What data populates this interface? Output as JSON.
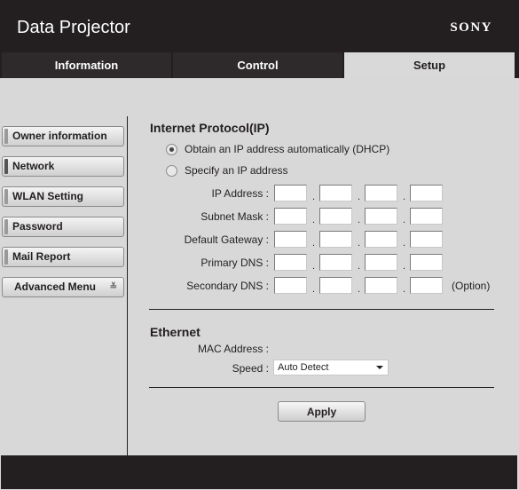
{
  "header": {
    "title": "Data Projector",
    "brand": "SONY"
  },
  "tabs": [
    {
      "label": "Information",
      "active": false
    },
    {
      "label": "Control",
      "active": false
    },
    {
      "label": "Setup",
      "active": true
    }
  ],
  "sidebar": {
    "items": [
      {
        "label": "Owner information"
      },
      {
        "label": "Network",
        "active": true
      },
      {
        "label": "WLAN Setting"
      },
      {
        "label": "Password"
      },
      {
        "label": "Mail Report"
      },
      {
        "label": "Advanced Menu",
        "icon": "double-chevron-down-icon",
        "glyph": "≚"
      }
    ]
  },
  "ip": {
    "title": "Internet Protocol(IP)",
    "options": [
      {
        "label": "Obtain an IP address automatically (DHCP)",
        "selected": true
      },
      {
        "label": "Specify an IP address",
        "selected": false
      }
    ],
    "fields": [
      {
        "label": "IP Address :",
        "values": [
          "",
          "",
          "",
          ""
        ]
      },
      {
        "label": "Subnet Mask :",
        "values": [
          "",
          "",
          "",
          ""
        ]
      },
      {
        "label": "Default Gateway :",
        "values": [
          "",
          "",
          "",
          ""
        ]
      },
      {
        "label": "Primary DNS :",
        "values": [
          "",
          "",
          "",
          ""
        ]
      },
      {
        "label": "Secondary DNS :",
        "values": [
          "",
          "",
          "",
          ""
        ],
        "note": "(Option)"
      }
    ],
    "separator": "."
  },
  "ethernet": {
    "title": "Ethernet",
    "mac_label": "MAC Address :",
    "mac_value": "",
    "speed_label": "Speed :",
    "speed_value": "Auto Detect"
  },
  "apply_label": "Apply"
}
